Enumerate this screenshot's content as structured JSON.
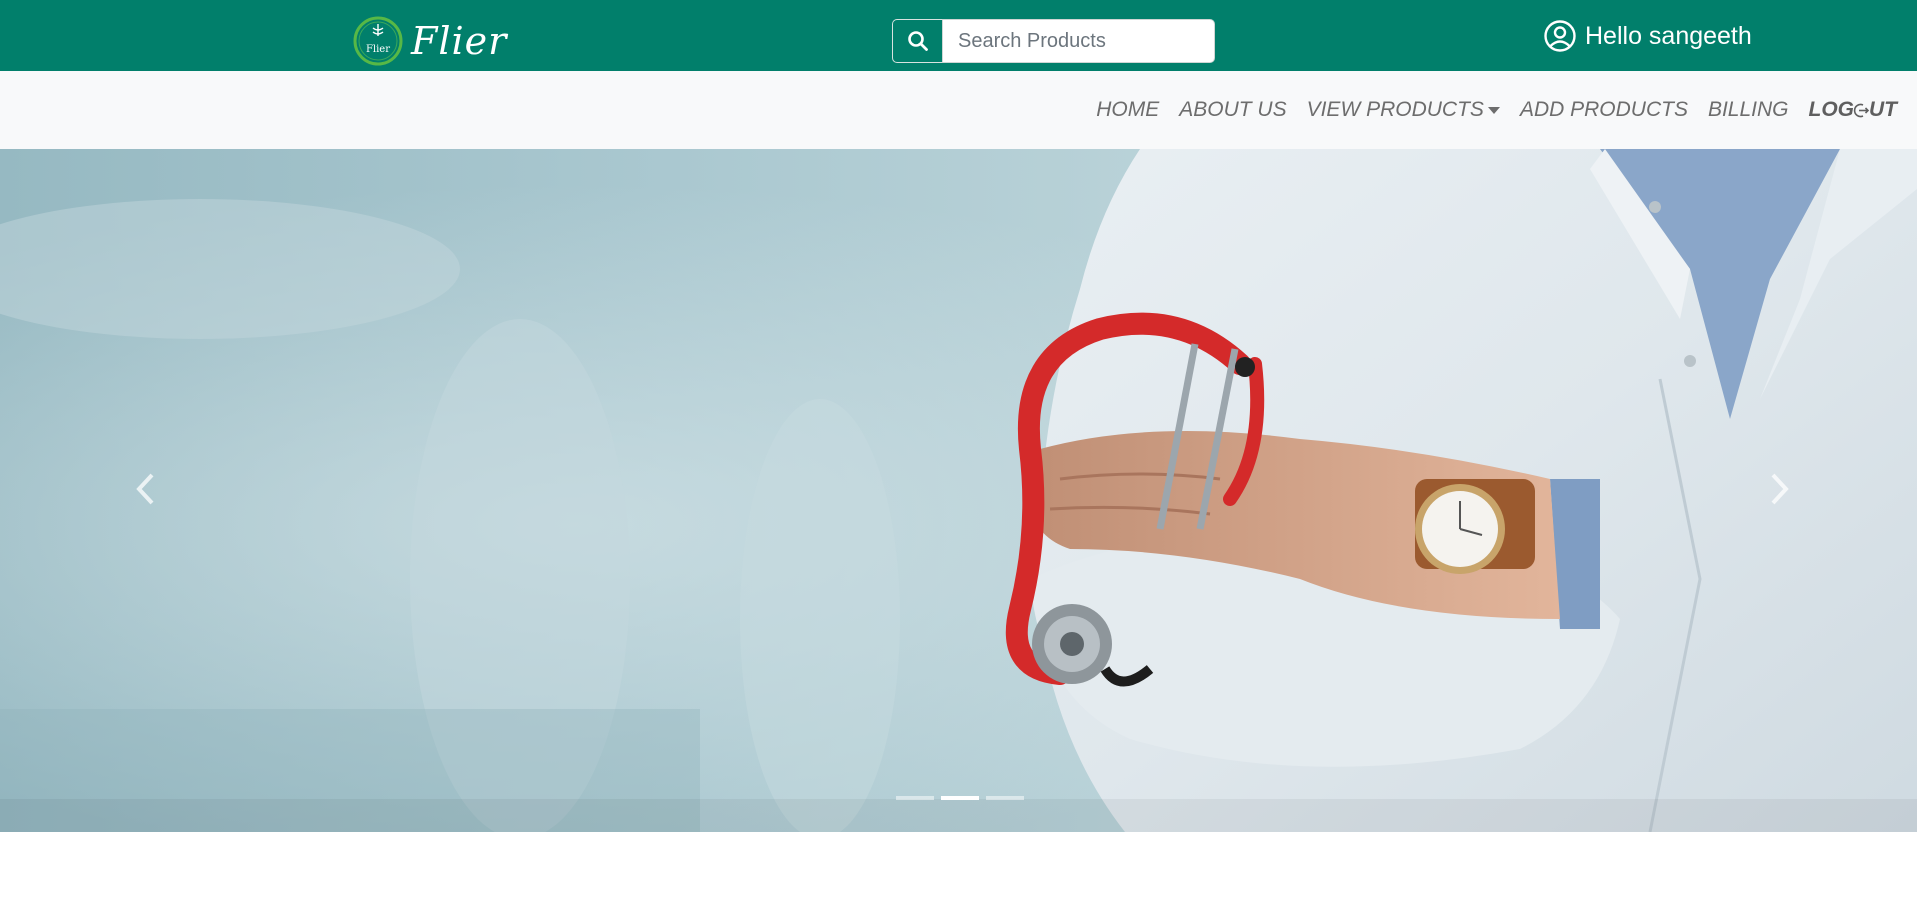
{
  "header": {
    "brand_name": "Flier",
    "logo_text": "Flier",
    "search": {
      "placeholder": "Search Products",
      "value": ""
    },
    "greeting": "Hello sangeeth"
  },
  "nav": {
    "items": [
      {
        "label": "HOME"
      },
      {
        "label": "ABOUT US"
      },
      {
        "label": "VIEW PRODUCTS",
        "has_dropdown": true
      },
      {
        "label": "ADD PRODUCTS"
      },
      {
        "label": "BILLING"
      }
    ],
    "logout_prefix": "LOG",
    "logout_suffix": "UT"
  },
  "carousel": {
    "slide_count": 3,
    "active_index": 1,
    "prev_icon": "chevron-left-icon",
    "next_icon": "chevron-right-icon"
  },
  "colors": {
    "header_bg": "#017f6b",
    "navbar_bg": "#f8f9fa",
    "nav_text": "#6d6d6d",
    "stethoscope": "#d42a2a"
  }
}
